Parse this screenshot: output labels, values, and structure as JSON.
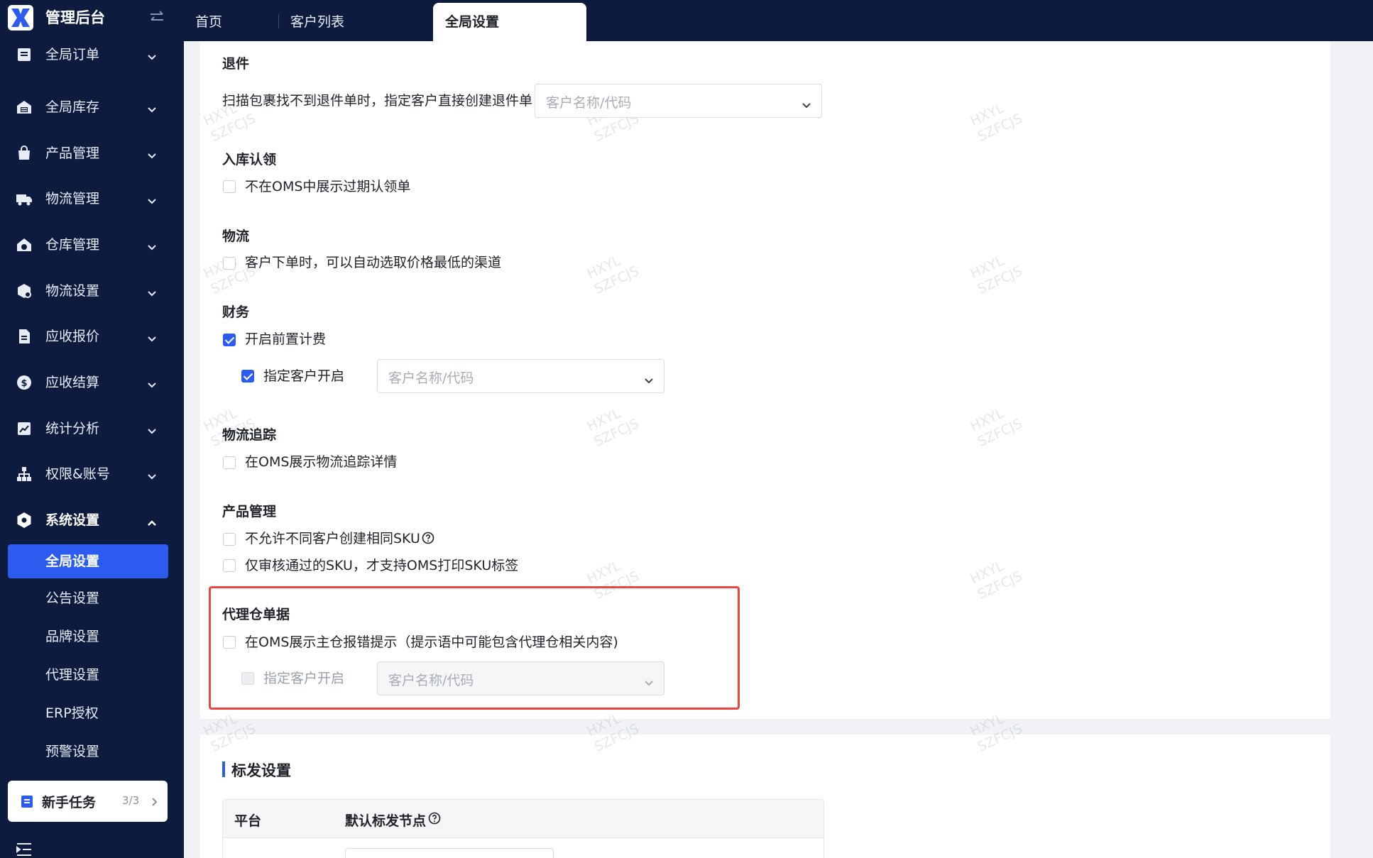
{
  "app": {
    "title": "管理后台"
  },
  "tabs": [
    {
      "label": "首页"
    },
    {
      "label": "客户列表"
    },
    {
      "label": "全局设置"
    }
  ],
  "sidebar": {
    "items": [
      {
        "label": "全局订单",
        "icon": "order-icon"
      },
      {
        "label": "全局库存",
        "icon": "inventory-icon"
      },
      {
        "label": "产品管理",
        "icon": "product-icon"
      },
      {
        "label": "物流管理",
        "icon": "truck-icon"
      },
      {
        "label": "仓库管理",
        "icon": "warehouse-icon"
      },
      {
        "label": "物流设置",
        "icon": "logistics-settings-icon"
      },
      {
        "label": "应收报价",
        "icon": "quote-icon"
      },
      {
        "label": "应收结算",
        "icon": "settlement-icon"
      },
      {
        "label": "统计分析",
        "icon": "chart-icon"
      },
      {
        "label": "权限&账号",
        "icon": "org-icon"
      },
      {
        "label": "系统设置",
        "icon": "system-settings-icon"
      }
    ],
    "subitems": [
      {
        "label": "全局设置",
        "active": true
      },
      {
        "label": "公告设置"
      },
      {
        "label": "品牌设置"
      },
      {
        "label": "代理设置"
      },
      {
        "label": "ERP授权"
      },
      {
        "label": "预警设置"
      }
    ],
    "task": {
      "label": "新手任务",
      "count": "3/3"
    }
  },
  "settings": {
    "return": {
      "title": "退件",
      "row_label": "扫描包裹找不到退件单时，指定客户直接创建退件单",
      "select_placeholder": "客户名称/代码"
    },
    "inbound": {
      "title": "入库认领",
      "option": "不在OMS中展示过期认领单",
      "checked": false
    },
    "logistics": {
      "title": "物流",
      "option": "客户下单时，可以自动选取价格最低的渠道",
      "checked": false
    },
    "finance": {
      "title": "财务",
      "option": "开启前置计费",
      "checked": true,
      "sub_option": "指定客户开启",
      "sub_checked": true,
      "select_placeholder": "客户名称/代码"
    },
    "tracking": {
      "title": "物流追踪",
      "option": "在OMS展示物流追踪详情",
      "checked": false
    },
    "product": {
      "title": "产品管理",
      "option1": "不允许不同客户创建相同SKU",
      "option2": "仅审核通过的SKU，才支持OMS打印SKU标签",
      "checked1": false,
      "checked2": false
    },
    "agent": {
      "title": "代理仓单据",
      "option": "在OMS展示主仓报错提示（提示语中可能包含代理仓相关内容)",
      "checked": false,
      "sub_option": "指定客户开启",
      "sub_disabled": true,
      "select_placeholder": "客户名称/代码"
    }
  },
  "shipping": {
    "title": "标发设置",
    "columns": [
      "平台",
      "默认标发节点"
    ]
  },
  "watermark": {
    "line1": "HXYL",
    "line2": "SZFCJS"
  },
  "colors": {
    "nav_bg": "#0d1b3e",
    "accent": "#2b5bef",
    "highlight": "#e8463e"
  }
}
